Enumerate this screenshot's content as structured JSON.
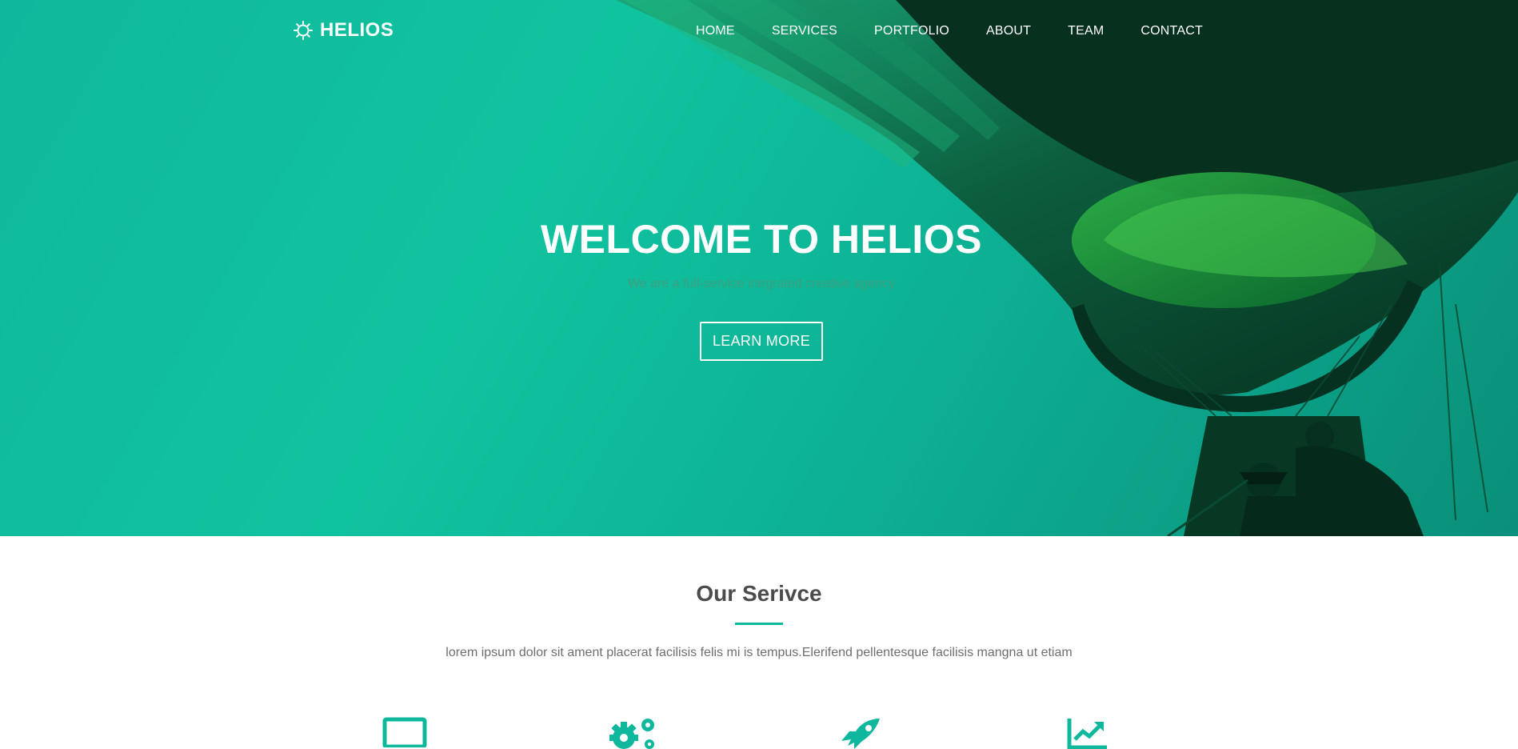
{
  "brand": {
    "name": "HELIOS",
    "icon": "sun-icon"
  },
  "nav": {
    "items": [
      {
        "label": "HOME"
      },
      {
        "label": "SERVICES"
      },
      {
        "label": "PORTFOLIO"
      },
      {
        "label": "ABOUT"
      },
      {
        "label": "TEAM"
      },
      {
        "label": "CONTACT"
      }
    ]
  },
  "hero": {
    "title": "WELCOME TO HELIOS",
    "subtitle": "We are a full-service intrgrated creative agency",
    "button_label": "LEARN MORE"
  },
  "services": {
    "title": "Our Serivce",
    "description": "lorem ipsum dolor sit ament placerat facilisis felis mi is tempus.Elerifend pellentesque facilisis mangna ut etiam",
    "icons": [
      "laptop-icon",
      "gears-icon",
      "rocket-icon",
      "chart-icon"
    ]
  },
  "colors": {
    "accent": "#0fb89c",
    "hero_dark": "#073a28",
    "text_dark": "#4b4b4b",
    "text_muted": "#6e6e6e"
  }
}
